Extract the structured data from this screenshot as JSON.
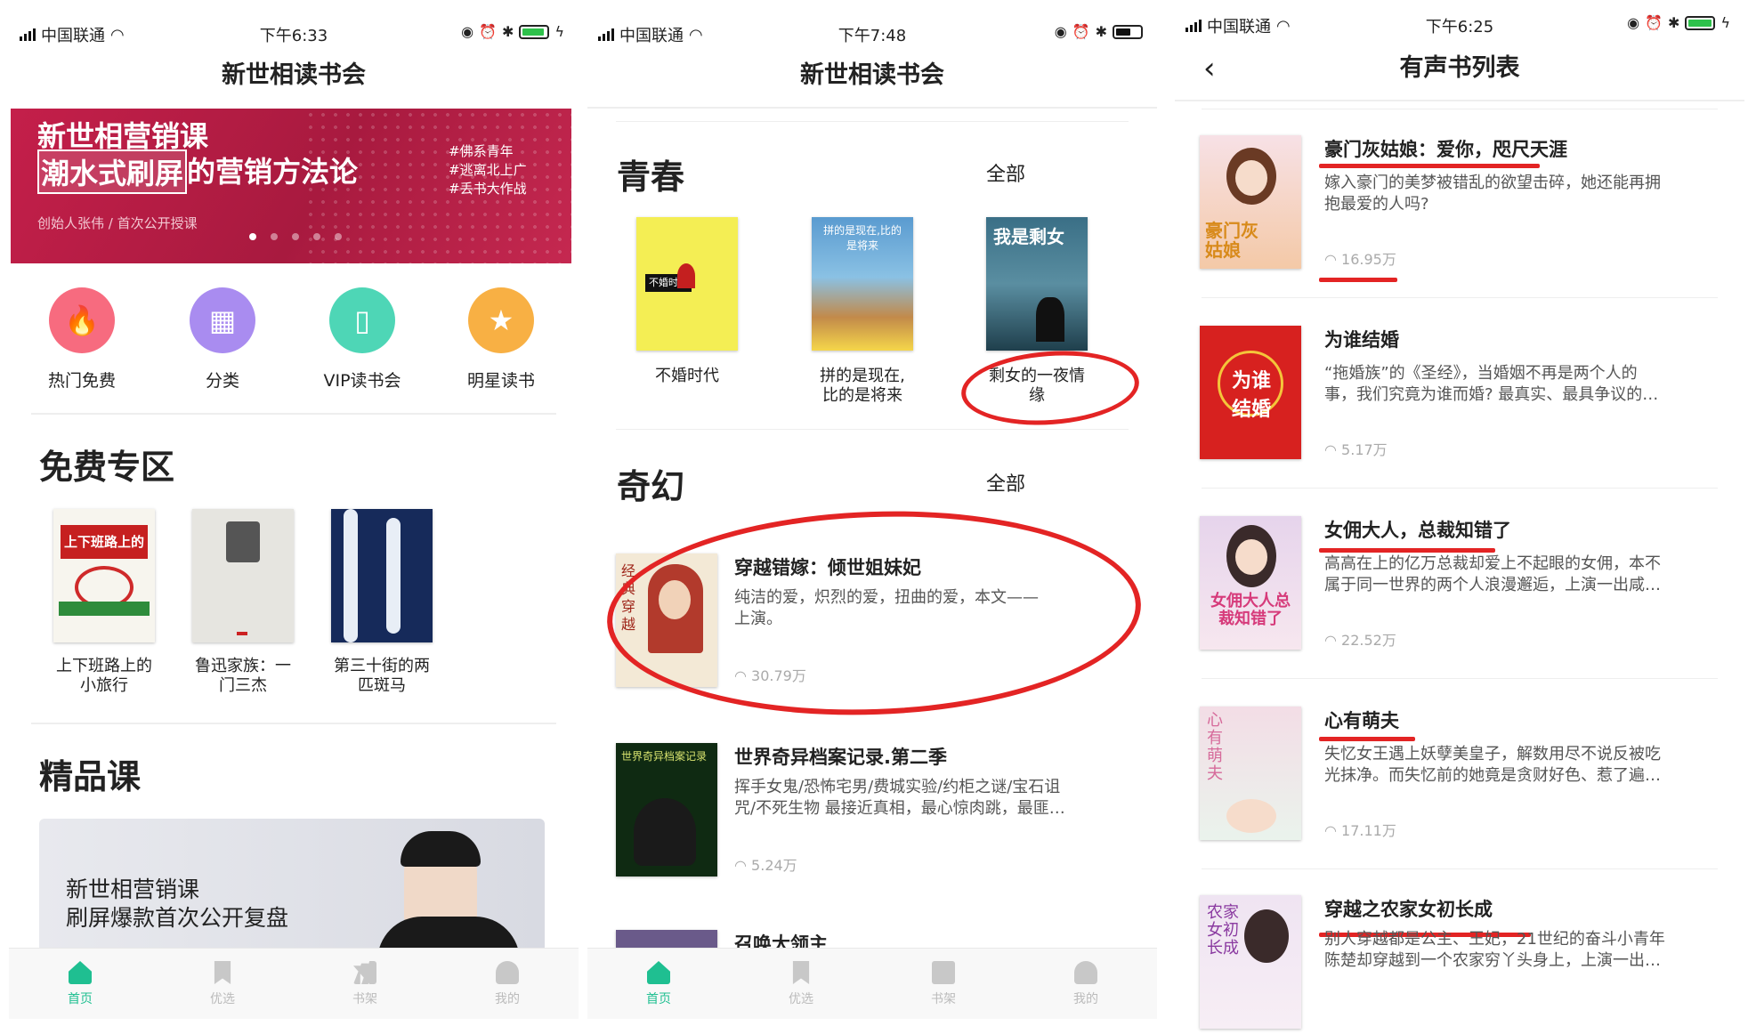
{
  "screen1": {
    "status": {
      "carrier": "中国联通",
      "time": "下午6:33"
    },
    "nav_title": "新世相读书会",
    "banner": {
      "line1": "新世相营销课",
      "line2a": "潮水式刷屏",
      "line2b": "的营销方法论",
      "tags": [
        "#佛系青年",
        "#逃离北上广",
        "#丢书大作战"
      ],
      "footer": "创始人张伟 / 首次公开授课"
    },
    "categories": [
      {
        "label": "热门免费",
        "color": "#f76b7f",
        "icon": "flame-icon"
      },
      {
        "label": "分类",
        "color": "#a98cf0",
        "icon": "grid-icon"
      },
      {
        "label": "VIP读书会",
        "color": "#4ed6b6",
        "icon": "book-icon"
      },
      {
        "label": "明星读书",
        "color": "#f8b044",
        "icon": "star-icon"
      }
    ],
    "free_section": "免费专区",
    "free_books": [
      "上下班路上的\n小旅行",
      "鲁迅家族：一\n门三杰",
      "第三十街的两\n匹斑马"
    ],
    "premium_section": "精品课",
    "course": {
      "line1": "新世相营销课",
      "line2": "刷屏爆款首次公开复盘"
    }
  },
  "screen2": {
    "status": {
      "carrier": "中国联通",
      "time": "下午7:48"
    },
    "nav_title": "新世相读书会",
    "youth_section": "青春",
    "fantasy_section": "奇幻",
    "all_label": "全部",
    "youth_books": [
      "不婚时代",
      "拼的是现在,\n比的是将来",
      "剩女的一夜情\n缘"
    ],
    "fantasy_list": [
      {
        "title": "穿越错嫁：倾世姐妹妃",
        "desc": "纯洁的爱，炽烈的爱，扭曲的爱，本文——\n上演。",
        "count": "30.79万"
      },
      {
        "title": "世界奇异档案记录.第二季",
        "desc": "挥手女鬼/恐怖宅男/费城实验/约柜之谜/宝石诅\n咒/不死生物 最接近真相，最心惊肉跳，最匪…",
        "count": "5.24万"
      },
      {
        "title": "召唤大领主",
        "desc": "",
        "count": ""
      }
    ]
  },
  "screen3": {
    "status": {
      "carrier": "中国联通",
      "time": "下午6:25"
    },
    "nav_title": "有声书列表",
    "items": [
      {
        "title": "豪门灰姑娘：爱你，咫尺天涯",
        "desc": "嫁入豪门的美梦被错乱的欲望击碎，她还能再拥\n抱最爱的人吗?",
        "count": "16.95万"
      },
      {
        "title": "为谁结婚",
        "desc": "“拖婚族”的《圣经》，当婚姻不再是两个人的\n事，我们究竟为谁而婚? 最真实、最具争议的…",
        "count": "5.17万"
      },
      {
        "title": "女佣大人，总裁知错了",
        "desc": "高高在上的亿万总裁却爱上不起眼的女佣，本不\n属于同一世界的两个人浪漫邂逅，上演一出咸…",
        "count": "22.52万"
      },
      {
        "title": "心有萌夫",
        "desc": "失忆女王遇上妖孽美皇子，解数用尽不说反被吃\n光抹净。而失忆前的她竟是贪财好色、惹了遍…",
        "count": "17.11万"
      },
      {
        "title": "穿越之农家女初长成",
        "desc": "别人穿越都是公主、王妃，21世纪的奋斗小青年\n陈楚却穿越到一个农家穷丫头身上，上演一出…",
        "count": ""
      }
    ]
  },
  "tabs": [
    "首页",
    "优选",
    "书架",
    "我的"
  ]
}
